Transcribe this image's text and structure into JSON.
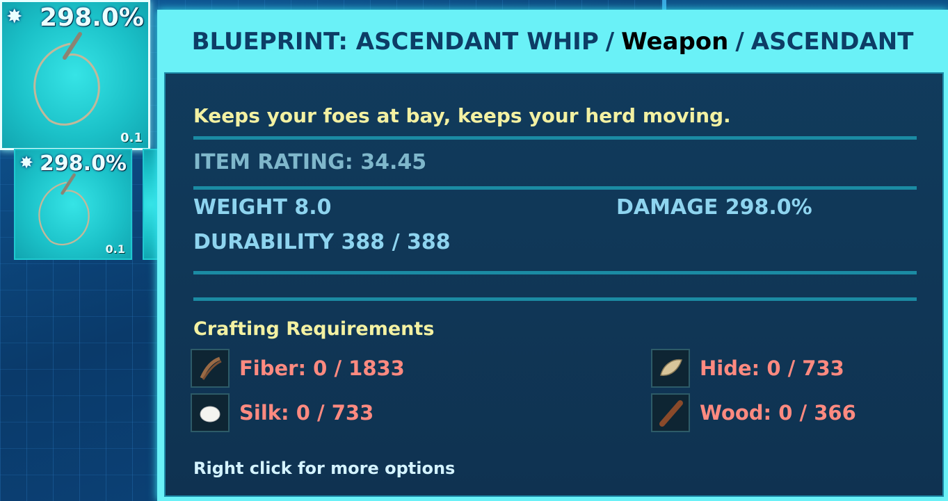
{
  "inventory": {
    "slots": [
      {
        "damage": "298.0%",
        "weight": "0.1"
      },
      {
        "damage": "298.0%",
        "weight": "0.1"
      }
    ]
  },
  "tooltip": {
    "header": {
      "name": "BLUEPRINT: ASCENDANT WHIP",
      "separator": "/",
      "category": "Weapon",
      "quality": "ASCENDANT"
    },
    "description": "Keeps your foes at bay, keeps your herd moving.",
    "item_rating": "ITEM RATING: 34.45",
    "weight": "WEIGHT 8.0",
    "damage": "DAMAGE 298.0%",
    "durability": "DURABILITY 388 / 388",
    "crafting_title": "Crafting Requirements",
    "resources": [
      {
        "icon": "fiber-icon",
        "label": "Fiber: 0 / 1833"
      },
      {
        "icon": "hide-icon",
        "label": "Hide: 0 / 733"
      },
      {
        "icon": "silk-icon",
        "label": "Silk: 0 / 733"
      },
      {
        "icon": "wood-icon",
        "label": "Wood: 0 / 366"
      }
    ],
    "hint": "Right click for more options"
  },
  "colors": {
    "header_bg": "#6af1f7",
    "header_text": "#0d3d66",
    "flavor_text": "#f3f1a2",
    "stat_text": "#8ed4ef",
    "resource_missing": "#ff8a80",
    "slot_bg": "#1bc1c8"
  }
}
